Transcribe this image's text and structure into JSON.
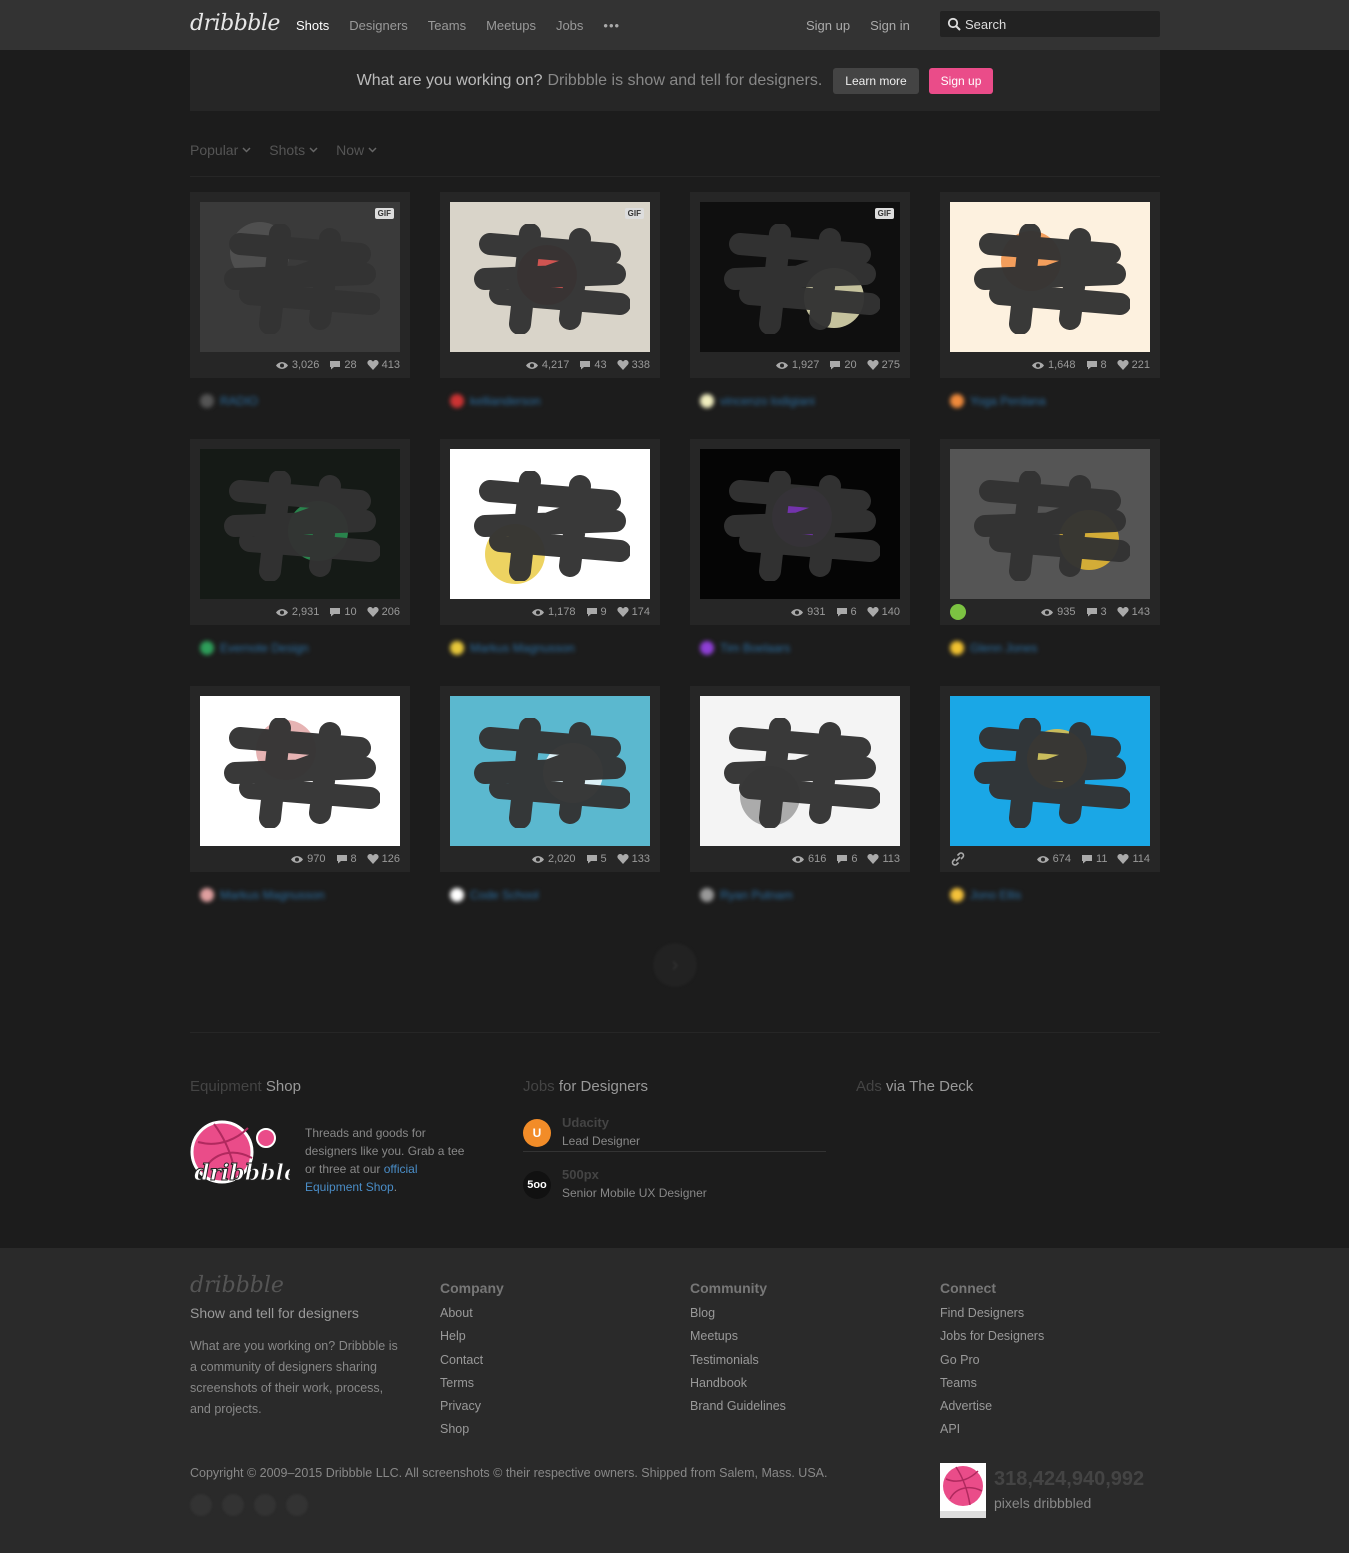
{
  "header": {
    "logo": "dribbble",
    "nav": [
      "Shots",
      "Designers",
      "Teams",
      "Meetups",
      "Jobs"
    ],
    "more": "•••",
    "sign_up": "Sign up",
    "sign_in": "Sign in",
    "search_placeholder": "Search"
  },
  "promo": {
    "question": "What are you working on?",
    "text": "Dribbble is show and tell for designers.",
    "learn_more": "Learn more",
    "sign_up": "Sign up"
  },
  "filters": [
    "Popular",
    "Shots",
    "Now"
  ],
  "shots": [
    {
      "views": "3,026",
      "comments": "28",
      "likes": "413",
      "author": "RADIO",
      "gif": true,
      "bg": "#3a3a3a",
      "accent": "#555"
    },
    {
      "views": "4,217",
      "comments": "43",
      "likes": "338",
      "author": "kellianderson",
      "gif": true,
      "bg": "#d9d4c9",
      "accent": "#c33"
    },
    {
      "views": "1,927",
      "comments": "20",
      "likes": "275",
      "author": "vincenzo lodigiani",
      "gif": true,
      "bg": "#0f0f0f",
      "accent": "#f2efc0"
    },
    {
      "views": "1,648",
      "comments": "8",
      "likes": "221",
      "author": "Yoga Perdana",
      "gif": false,
      "bg": "#fdf1df",
      "accent": "#f08a3b"
    },
    {
      "views": "2,931",
      "comments": "10",
      "likes": "206",
      "author": "Evernote Design",
      "gif": false,
      "bg": "#151a16",
      "accent": "#2e9e5a"
    },
    {
      "views": "1,178",
      "comments": "9",
      "likes": "174",
      "author": "Markus Magnusson",
      "gif": false,
      "bg": "#ffffff",
      "accent": "#e8c83a"
    },
    {
      "views": "931",
      "comments": "6",
      "likes": "140",
      "author": "Tim Boelaars",
      "gif": false,
      "bg": "#050505",
      "accent": "#8e3fd6"
    },
    {
      "views": "935",
      "comments": "3",
      "likes": "143",
      "author": "Glenn Jones",
      "gif": false,
      "bg": "#555555",
      "accent": "#f2c230"
    },
    {
      "views": "970",
      "comments": "8",
      "likes": "126",
      "author": "Markus Magnusson",
      "gif": false,
      "bg": "#ffffff",
      "accent": "#e0a0a0"
    },
    {
      "views": "2,020",
      "comments": "5",
      "likes": "133",
      "author": "Code School",
      "gif": false,
      "bg": "#5bb8cf",
      "accent": "#ffffff"
    },
    {
      "views": "616",
      "comments": "6",
      "likes": "113",
      "author": "Ryan Putnam",
      "gif": false,
      "bg": "#f4f4f4",
      "accent": "#999"
    },
    {
      "views": "674",
      "comments": "11",
      "likes": "114",
      "author": "Jono Ellis",
      "gif": false,
      "bg": "#1aa7e6",
      "accent": "#f5c23a"
    }
  ],
  "widgets": {
    "shop": {
      "dim": "Equipment",
      "bright": " Shop",
      "text": "Threads and goods for designers like you. Grab a tee or three at our ",
      "link": "official Equipment Shop",
      "end": "."
    },
    "jobs": {
      "dim": "Jobs",
      "bright": " for Designers",
      "items": [
        {
          "company": "Udacity",
          "role": "Lead Designer",
          "logo": "U"
        },
        {
          "company": "500px",
          "role": "Senior Mobile UX Designer",
          "logo": "5oo"
        }
      ]
    },
    "ads": {
      "dim": "Ads",
      "bright": " via The Deck"
    }
  },
  "footer": {
    "logo": "dribbble",
    "tagline": "Show and tell for designers",
    "description": "What are you working on? Dribbble is a community of designers sharing screenshots of their work, process, and projects.",
    "columns": [
      {
        "title": "Company",
        "links": [
          "About",
          "Help",
          "Contact",
          "Terms",
          "Privacy",
          "Shop"
        ]
      },
      {
        "title": "Community",
        "links": [
          "Blog",
          "Meetups",
          "Testimonials",
          "Handbook",
          "Brand Guidelines"
        ]
      },
      {
        "title": "Connect",
        "links": [
          "Find Designers",
          "Jobs for Designers",
          "Go Pro",
          "Teams",
          "Advertise",
          "API"
        ]
      }
    ],
    "copyright": "Copyright © 2009–2015 Dribbble LLC. All screenshots © their respective owners. Shipped from Salem, Mass. USA.",
    "pixels_count": "318,424,940,992",
    "pixels_label": "pixels dribbbled"
  },
  "colors": {
    "accent": "#ea4c89",
    "link": "#4a8dc7"
  }
}
